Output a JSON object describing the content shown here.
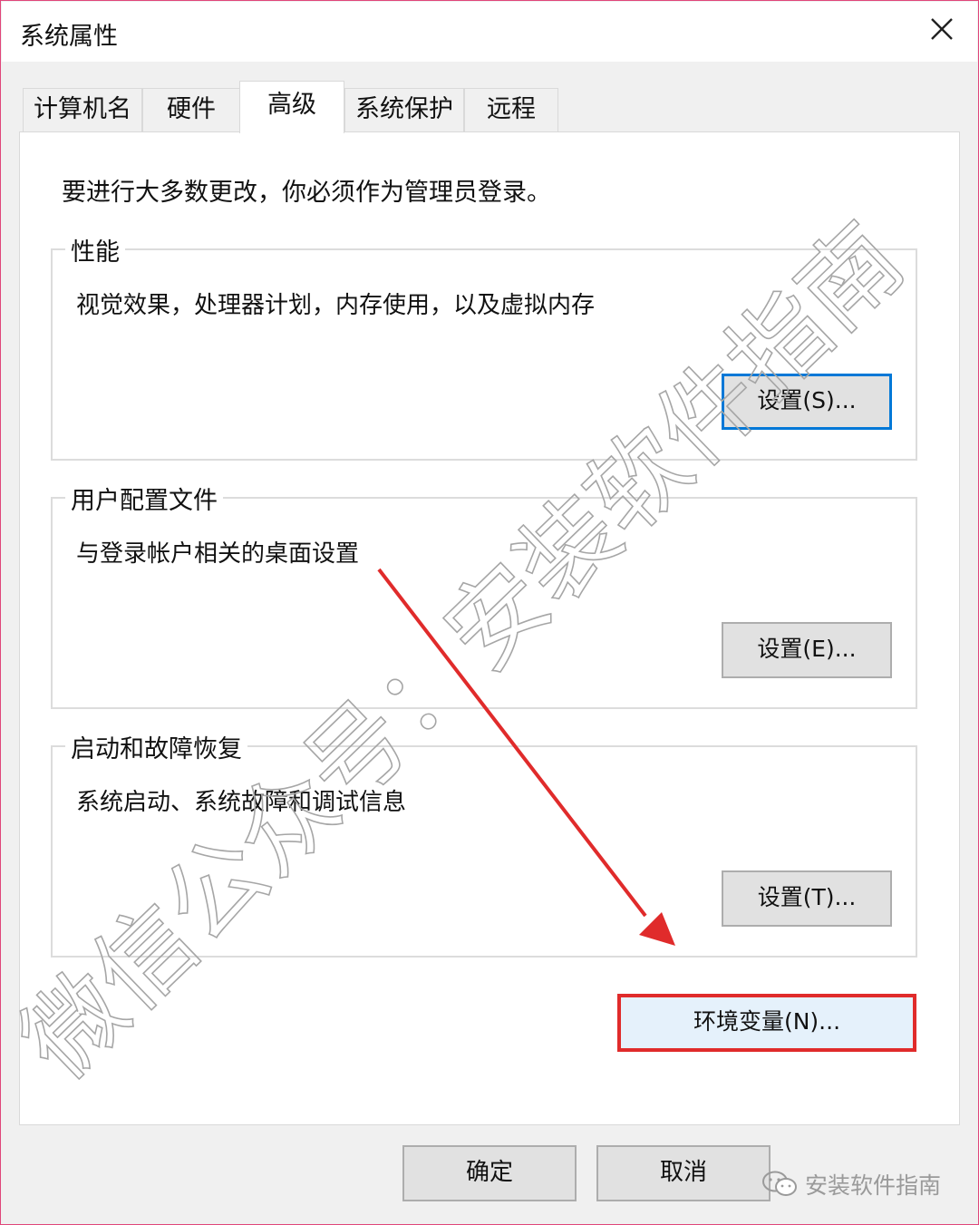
{
  "window": {
    "title": "系统属性"
  },
  "tabs": [
    {
      "label": "计算机名"
    },
    {
      "label": "硬件"
    },
    {
      "label": "高级"
    },
    {
      "label": "系统保护"
    },
    {
      "label": "远程"
    }
  ],
  "active_tab": "高级",
  "admin_note": "要进行大多数更改，你必须作为管理员登录。",
  "groups": {
    "performance": {
      "title": "性能",
      "description": "视觉效果，处理器计划，内存使用，以及虚拟内存",
      "button": "设置(S)..."
    },
    "user_profiles": {
      "title": "用户配置文件",
      "description": "与登录帐户相关的桌面设置",
      "button": "设置(E)..."
    },
    "startup_recovery": {
      "title": "启动和故障恢复",
      "description": "系统启动、系统故障和调试信息",
      "button": "设置(T)..."
    }
  },
  "env_button": "环境变量(N)...",
  "footer": {
    "ok": "确定",
    "cancel": "取消"
  },
  "watermark": {
    "text": "微信公众号：安装软件指南",
    "brand": "安装软件指南"
  },
  "colors": {
    "highlight_border": "#e02b2b",
    "arrow": "#e02b2b",
    "focus_border": "#0078d7",
    "window_border": "#e0467a"
  },
  "icons": {
    "close": "close-icon",
    "brand": "wechat-icon",
    "arrow": "arrow-annotation"
  }
}
